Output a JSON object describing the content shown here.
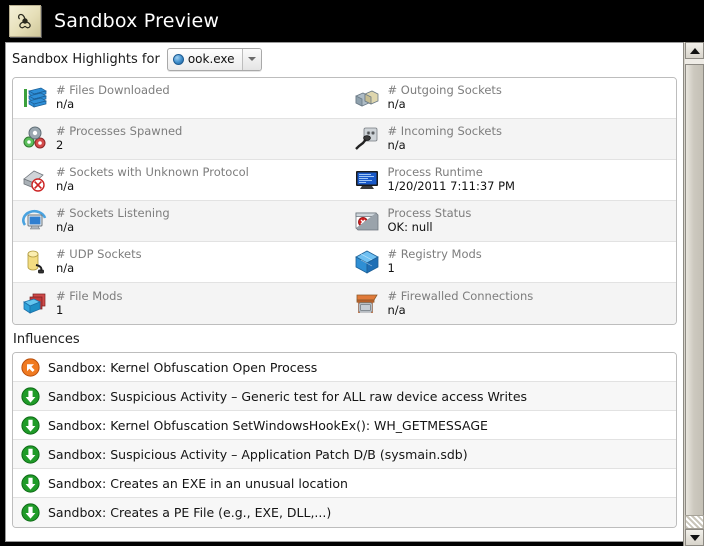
{
  "window": {
    "title": "Sandbox Preview",
    "icon": "biohazard-icon"
  },
  "highlights": {
    "label": "Sandbox Highlights for",
    "combo": {
      "value": "ook.exe",
      "icon": "blue-sphere-icon",
      "arrow_icon": "chevron-down-icon"
    },
    "stats": [
      {
        "label": "# Files Downloaded",
        "value": "n/a",
        "icon": "database-stack-icon"
      },
      {
        "label": "# Outgoing Sockets",
        "value": "n/a",
        "icon": "network-sockets-icon"
      },
      {
        "label": "# Processes Spawned",
        "value": "2",
        "icon": "gears-icon"
      },
      {
        "label": "# Incoming Sockets",
        "value": "n/a",
        "icon": "power-plug-icon"
      },
      {
        "label": "# Sockets with Unknown Protocol",
        "value": "n/a",
        "icon": "unknown-socket-icon"
      },
      {
        "label": "Process Runtime",
        "value": "1/20/2011 7:11:37 PM",
        "icon": "monitor-icon"
      },
      {
        "label": "# Sockets Listening",
        "value": "n/a",
        "icon": "listening-monitor-icon"
      },
      {
        "label": "Process Status",
        "value": "OK: null",
        "icon": "window-alert-icon"
      },
      {
        "label": "# UDP Sockets",
        "value": "n/a",
        "icon": "udp-cylinder-icon"
      },
      {
        "label": "# Registry Mods",
        "value": "1",
        "icon": "registry-cube-icon"
      },
      {
        "label": "# File Mods",
        "value": "1",
        "icon": "file-mods-icon"
      },
      {
        "label": "# Firewalled Connections",
        "value": "n/a",
        "icon": "firewall-icon"
      }
    ]
  },
  "influences": {
    "title": "Influences",
    "items": [
      {
        "text": "Sandbox: Kernel Obfuscation Open Process",
        "icon": "orange-arrow-up-icon"
      },
      {
        "text": "Sandbox: Suspicious Activity – Generic test for ALL raw device access Writes",
        "icon": "green-arrow-down-icon"
      },
      {
        "text": "Sandbox: Kernel Obfuscation SetWindowsHookEx(): WH_GETMESSAGE",
        "icon": "green-arrow-down-icon"
      },
      {
        "text": "Sandbox: Suspicious Activity – Application Patch D/B (sysmain.sdb)",
        "icon": "green-arrow-down-icon"
      },
      {
        "text": "Sandbox: Creates an EXE in an unusual location",
        "icon": "green-arrow-down-icon"
      },
      {
        "text": "Sandbox: Creates a PE File (e.g., EXE, DLL,...)",
        "icon": "green-arrow-down-icon"
      }
    ]
  },
  "scrollbar": {
    "up_icon": "triangle-up-icon",
    "down_icon": "triangle-down-icon"
  },
  "colors": {
    "titlebar_bg": "#000000",
    "label_gray": "#7d7d7d",
    "influence_warn": "#e8761f",
    "influence_ok": "#1f9b28"
  }
}
